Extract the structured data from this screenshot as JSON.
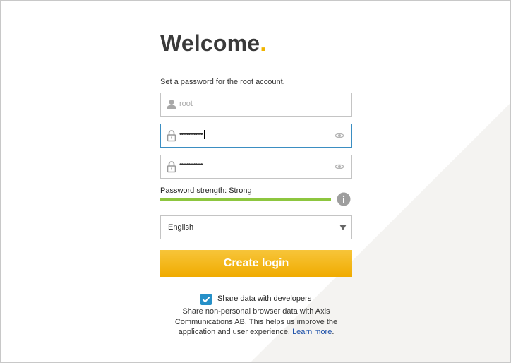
{
  "header": {
    "title": "Welcome",
    "title_dot": "."
  },
  "form": {
    "instruction": "Set a password for the root account.",
    "username": {
      "value": "root",
      "icon": "user-icon"
    },
    "password": {
      "masked_value": "•••••••••••••",
      "icon": "lock-icon",
      "toggle_icon": "eye-icon"
    },
    "confirm_password": {
      "masked_value": "•••••••••••••",
      "icon": "lock-icon",
      "toggle_icon": "eye-icon"
    },
    "strength": {
      "label": "Password strength: Strong",
      "level": 1.0,
      "color": "#8dc63f",
      "info_icon": "info-icon"
    },
    "language": {
      "selected": "English"
    },
    "submit_label": "Create login",
    "share": {
      "checked": true,
      "label": "Share data with developers",
      "description": "Share non-personal browser data with Axis Communications AB. This helps us improve the application and user experience.",
      "link_text": "Learn more",
      "after_link": "."
    }
  },
  "colors": {
    "accent": "#f0b400",
    "button": "#f0ab00",
    "checkbox": "#2690c8",
    "link": "#1c4fa8",
    "active_border": "#3b8ec2"
  }
}
